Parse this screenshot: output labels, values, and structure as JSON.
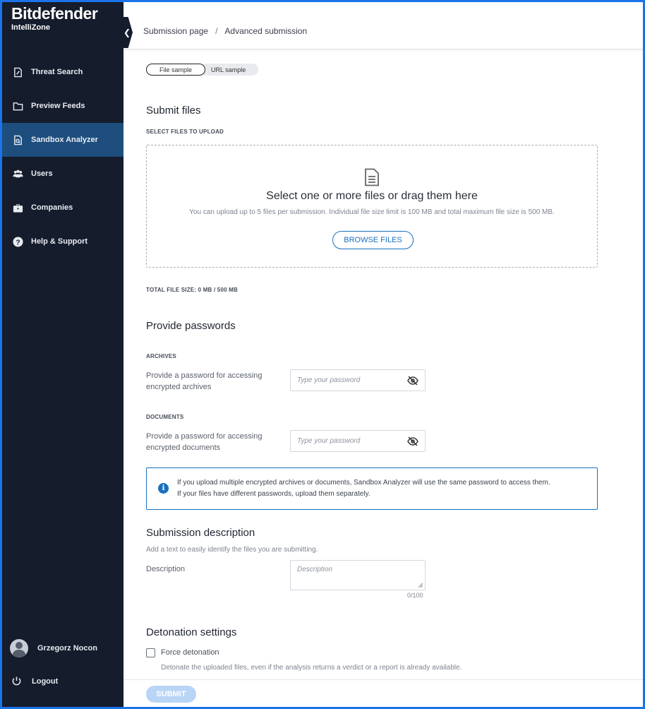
{
  "brand": {
    "name": "Bitdefender",
    "product": "IntelliZone"
  },
  "sidebar": {
    "items": [
      {
        "label": "Threat Search",
        "icon": "threat-search-icon"
      },
      {
        "label": "Preview Feeds",
        "icon": "folder-icon"
      },
      {
        "label": "Sandbox Analyzer",
        "icon": "sandbox-icon",
        "active": true
      },
      {
        "label": "Users",
        "icon": "users-icon"
      },
      {
        "label": "Companies",
        "icon": "briefcase-icon"
      },
      {
        "label": "Help & Support",
        "icon": "help-icon"
      }
    ],
    "user_name": "Grzegorz Nocon",
    "logout": "Logout"
  },
  "header": {
    "breadcrumb": [
      "Submission page",
      "Advanced submission"
    ],
    "separator": "/"
  },
  "tabs": {
    "file": "File sample",
    "url": "URL sample"
  },
  "submit_files": {
    "title": "Submit files",
    "caption": "SELECT FILES TO UPLOAD",
    "drop_title": "Select one or more files or drag them here",
    "drop_sub": "You can upload up to 5 files per submission. Individual file size limit is 100 MB and total maximum file size is 500 MB.",
    "browse": "BROWSE FILES",
    "total": "TOTAL FILE SIZE: 0 MB / 500 MB"
  },
  "passwords": {
    "title": "Provide passwords",
    "archives_caption": "ARCHIVES",
    "archives_label": "Provide a password for accessing encrypted archives",
    "archives_placeholder": "Type your password",
    "documents_caption": "DOCUMENTS",
    "documents_label": "Provide a password for accessing encrypted documents",
    "documents_placeholder": "Type your password",
    "info_line1": "If you upload multiple encrypted archives or documents, Sandbox Analyzer will use the same password to access them.",
    "info_line2": "If your files have different passwords, upload them separately."
  },
  "description": {
    "title": "Submission description",
    "hint": "Add a text to easily identify the files you are submitting.",
    "label": "Description",
    "placeholder": "Description",
    "counter": "0/100"
  },
  "detonation": {
    "title": "Detonation settings",
    "force_label": "Force detonation",
    "force_hint": "Detonate the uploaded files, even if the analysis returns a verdict or a report is already available."
  },
  "submit": "SUBMIT",
  "colors": {
    "sidebar": "#151c2c",
    "active": "#1d4e7e",
    "accent": "#1a6fbf"
  }
}
